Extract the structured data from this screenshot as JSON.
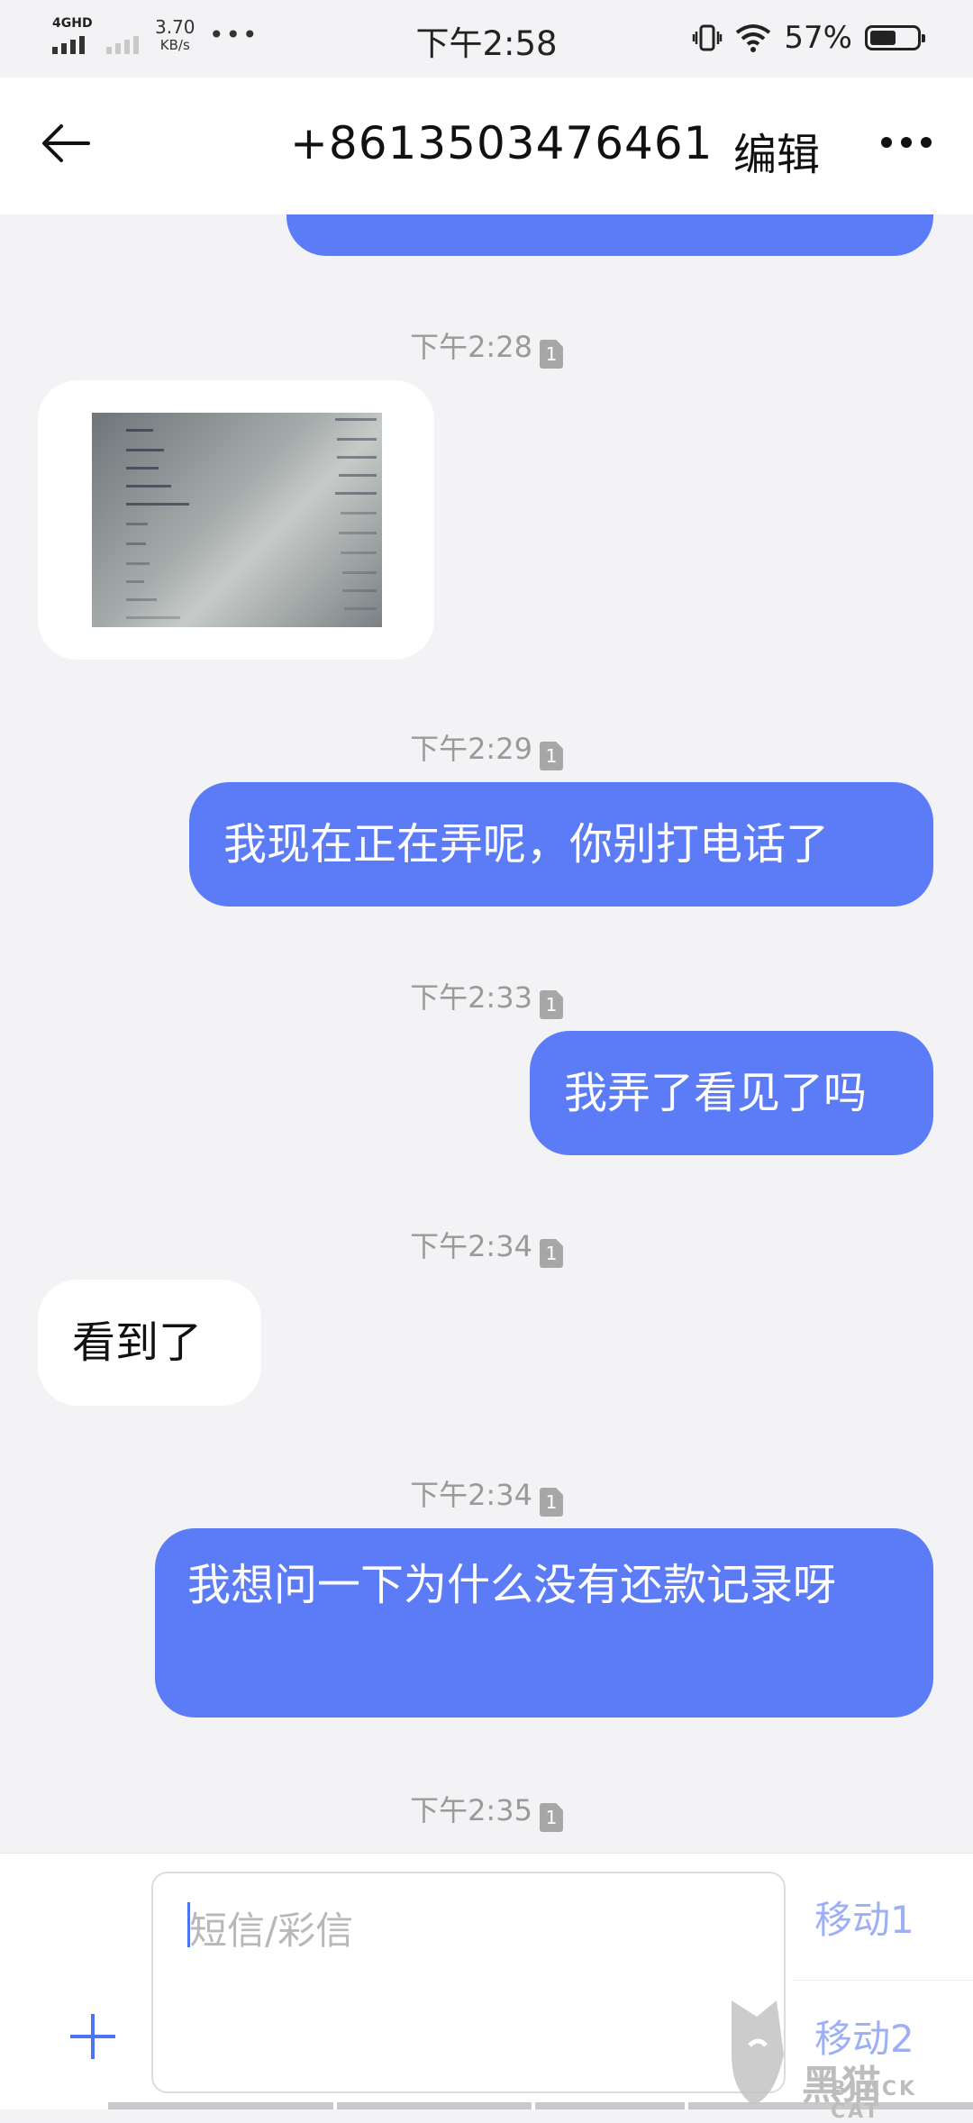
{
  "status_bar": {
    "network_type": "4GHD",
    "net_speed_value": "3.70",
    "net_speed_unit": "KB/s",
    "more_indicator": "•••",
    "time": "下午2:58",
    "battery_percent": "57%",
    "battery_level": 0.57
  },
  "header": {
    "title": "+8613503476461",
    "edit_label": "编辑"
  },
  "messages": [
    {
      "type": "timestamp",
      "text": "下午2:28",
      "sim": "1"
    },
    {
      "type": "image",
      "direction": "incoming"
    },
    {
      "type": "timestamp",
      "text": "下午2:29",
      "sim": "1"
    },
    {
      "type": "text",
      "direction": "outgoing",
      "text": "我现在正在弄呢，你别打电话了"
    },
    {
      "type": "timestamp",
      "text": "下午2:33",
      "sim": "1"
    },
    {
      "type": "text",
      "direction": "outgoing",
      "text": "我弄了看见了吗"
    },
    {
      "type": "timestamp",
      "text": "下午2:34",
      "sim": "1"
    },
    {
      "type": "text",
      "direction": "incoming",
      "text": "看到了"
    },
    {
      "type": "timestamp",
      "text": "下午2:34",
      "sim": "1"
    },
    {
      "type": "text",
      "direction": "outgoing",
      "text": "我想问一下为什么没有还款记录呀"
    },
    {
      "type": "timestamp",
      "text": "下午2:35",
      "sim": "1"
    }
  ],
  "input_bar": {
    "placeholder": "短信/彩信",
    "sim_option_1": "移动1",
    "sim_option_2": "移动2"
  },
  "watermark": {
    "text": "黑猫",
    "subtext": "BLACK CAT"
  },
  "colors": {
    "outgoing_bubble": "#5b7cf6",
    "incoming_bubble": "#ffffff",
    "accent": "#4f73f0",
    "background": "#f3f3f5"
  }
}
